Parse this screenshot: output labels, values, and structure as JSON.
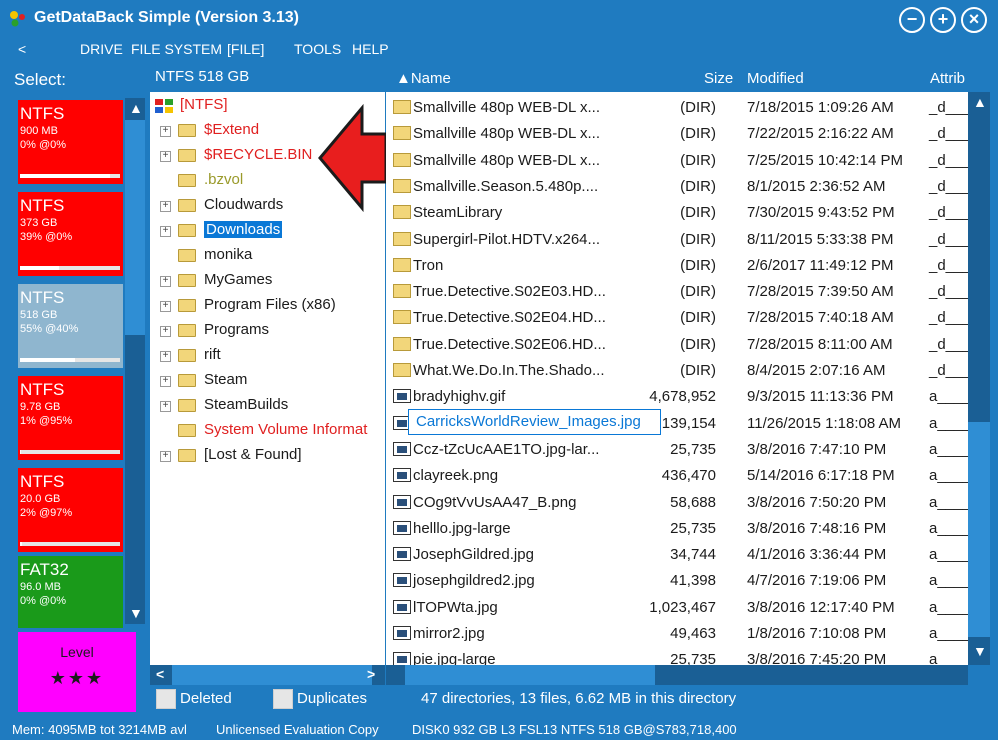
{
  "window": {
    "title": "GetDataBack Simple (Version 3.13)",
    "buttons": {
      "minimize": "−",
      "add": "+",
      "close": "×"
    }
  },
  "menu": {
    "back": "<",
    "items": [
      "DRIVE",
      "FILE SYSTEM",
      "[FILE]",
      "TOOLS",
      "HELP"
    ]
  },
  "drives": {
    "label": "Select:",
    "items": [
      {
        "fs": "NTFS",
        "size": "900 MB",
        "pct": "0% @0%",
        "color": "#ff0000",
        "usage": 0.9
      },
      {
        "fs": "NTFS",
        "size": "373 GB",
        "pct": "39% @0%",
        "color": "#ff0000",
        "usage": 0.39
      },
      {
        "fs": "NTFS",
        "size": "518 GB",
        "pct": "55% @40%",
        "color": "#8fb6cf",
        "usage": 0.55
      },
      {
        "fs": "NTFS",
        "size": "9.78 GB",
        "pct": "1% @95%",
        "color": "#ff0000",
        "usage": 0.01
      },
      {
        "fs": "NTFS",
        "size": "20.0 GB",
        "pct": "2% @97%",
        "color": "#ff0000",
        "usage": 0.02
      },
      {
        "fs": "FAT32",
        "size": "96.0 MB",
        "pct": "0% @0%",
        "color": "#1a9a1a",
        "usage": 0
      }
    ],
    "level": {
      "label": "Level",
      "stars": "★★★"
    }
  },
  "tree": {
    "header": "NTFS 518 GB",
    "items": [
      {
        "label": "[NTFS]",
        "color": "#e02020"
      },
      {
        "label": "$Extend",
        "color": "#e02020"
      },
      {
        "label": "$RECYCLE.BIN",
        "color": "#e02020"
      },
      {
        "label": ".bzvol",
        "color": "#9a9a2a"
      },
      {
        "label": "Cloudwards",
        "color": "#1b1b1b"
      },
      {
        "label": "Downloads",
        "color": "#ffffff"
      },
      {
        "label": "monika",
        "color": "#1b1b1b"
      },
      {
        "label": "MyGames",
        "color": "#1b1b1b"
      },
      {
        "label": "Program Files (x86)",
        "color": "#1b1b1b"
      },
      {
        "label": "Programs",
        "color": "#1b1b1b"
      },
      {
        "label": "rift",
        "color": "#1b1b1b"
      },
      {
        "label": "Steam",
        "color": "#1b1b1b"
      },
      {
        "label": "SteamBuilds",
        "color": "#1b1b1b"
      },
      {
        "label": "System Volume Informat",
        "color": "#e02020"
      },
      {
        "label": "[Lost & Found]",
        "color": "#1b1b1b"
      }
    ]
  },
  "list": {
    "columns": {
      "name": "▲Name",
      "size": "Size",
      "modified": "Modified",
      "attrib": "Attrib"
    },
    "rows": [
      {
        "name": "Smallville 480p WEB-DL x...",
        "size": "(DIR)",
        "modified": "7/18/2015 1:09:26 AM",
        "attrib": "_d___",
        "type": "dir"
      },
      {
        "name": "Smallville 480p WEB-DL x...",
        "size": "(DIR)",
        "modified": "7/22/2015 2:16:22 AM",
        "attrib": "_d___",
        "type": "dir"
      },
      {
        "name": "Smallville 480p WEB-DL x...",
        "size": "(DIR)",
        "modified": "7/25/2015 10:42:14 PM",
        "attrib": "_d___",
        "type": "dir"
      },
      {
        "name": "Smallville.Season.5.480p....",
        "size": "(DIR)",
        "modified": "8/1/2015 2:36:52 AM",
        "attrib": "_d___",
        "type": "dir"
      },
      {
        "name": "SteamLibrary",
        "size": "(DIR)",
        "modified": "7/30/2015 9:43:52 PM",
        "attrib": "_d___",
        "type": "dir"
      },
      {
        "name": "Supergirl-Pilot.HDTV.x264...",
        "size": "(DIR)",
        "modified": "8/11/2015 5:33:38 PM",
        "attrib": "_d___",
        "type": "dir"
      },
      {
        "name": "Tron",
        "size": "(DIR)",
        "modified": "2/6/2017 11:49:12 PM",
        "attrib": "_d___",
        "type": "dir"
      },
      {
        "name": "True.Detective.S02E03.HD...",
        "size": "(DIR)",
        "modified": "7/28/2015 7:39:50 AM",
        "attrib": "_d___",
        "type": "dir"
      },
      {
        "name": "True.Detective.S02E04.HD...",
        "size": "(DIR)",
        "modified": "7/28/2015 7:40:18 AM",
        "attrib": "_d___",
        "type": "dir"
      },
      {
        "name": "True.Detective.S02E06.HD...",
        "size": "(DIR)",
        "modified": "7/28/2015 8:11:00 AM",
        "attrib": "_d___",
        "type": "dir"
      },
      {
        "name": "What.We.Do.In.The.Shado...",
        "size": "(DIR)",
        "modified": "8/4/2015 2:07:16 AM",
        "attrib": "_d___",
        "type": "dir"
      },
      {
        "name": "bradyhighv.gif",
        "size": "4,678,952",
        "modified": "9/3/2015 11:13:36 PM",
        "attrib": "a____",
        "type": "file"
      },
      {
        "name": "",
        "size": "139,154",
        "modified": "11/26/2015 1:18:08 AM",
        "attrib": "a____",
        "type": "file"
      },
      {
        "name": "Ccz-tZcUcAAE1TO.jpg-lar...",
        "size": "25,735",
        "modified": "3/8/2016 7:47:10 PM",
        "attrib": "a____",
        "type": "file"
      },
      {
        "name": "clayreek.png",
        "size": "436,470",
        "modified": "5/14/2016 6:17:18 PM",
        "attrib": "a____",
        "type": "file"
      },
      {
        "name": "COg9tVvUsAA47_B.png",
        "size": "58,688",
        "modified": "3/8/2016 7:50:20 PM",
        "attrib": "a____",
        "type": "file"
      },
      {
        "name": "helllo.jpg-large",
        "size": "25,735",
        "modified": "3/8/2016 7:48:16 PM",
        "attrib": "a____",
        "type": "file"
      },
      {
        "name": "JosephGildred.jpg",
        "size": "34,744",
        "modified": "4/1/2016 3:36:44 PM",
        "attrib": "a____",
        "type": "file"
      },
      {
        "name": "josephgildred2.jpg",
        "size": "41,398",
        "modified": "4/7/2016 7:19:06 PM",
        "attrib": "a____",
        "type": "file"
      },
      {
        "name": "lTOPWta.jpg",
        "size": "1,023,467",
        "modified": "3/8/2016 12:17:40 PM",
        "attrib": "a____",
        "type": "file"
      },
      {
        "name": "mirror2.jpg",
        "size": "49,463",
        "modified": "1/8/2016 7:10:08 PM",
        "attrib": "a____",
        "type": "file"
      },
      {
        "name": "pie.jpg-large",
        "size": "25,735",
        "modified": "3/8/2016 7:45:20 PM",
        "attrib": "a____",
        "type": "file"
      }
    ],
    "tooltip": "CarricksWorldReview_Images.jpg"
  },
  "legend": {
    "deleted": "Deleted",
    "duplicates": "Duplicates"
  },
  "status": {
    "directory": "47 directories, 13 files, 6.62 MB in this directory",
    "memory": "Mem: 4095MB tot 3214MB avl",
    "license": "Unlicensed Evaluation Copy",
    "disk": "DISK0 932 GB L3 FSL13 NTFS 518 GB@S783,718,400"
  }
}
